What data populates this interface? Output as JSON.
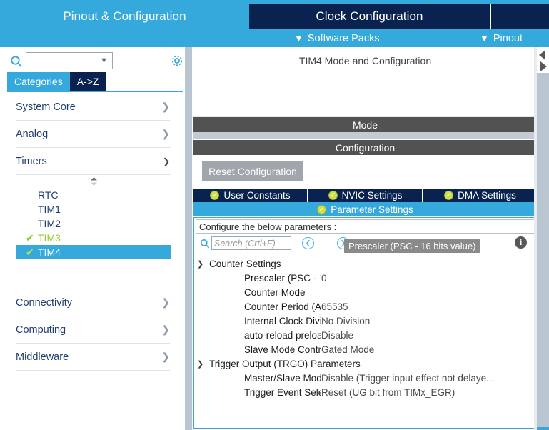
{
  "topbar": {
    "tabs": [
      {
        "label": "Pinout & Configuration",
        "state": "active-light"
      },
      {
        "label": "Clock Configuration",
        "state": "active-dark"
      }
    ],
    "subitems": [
      {
        "label": "Software Packs",
        "icon": "chevron-down-icon"
      },
      {
        "label": "Pinout",
        "icon": "chevron-down-icon"
      }
    ],
    "accent_blue": "#35a8dc",
    "navy": "#0a2250"
  },
  "sidebar": {
    "search": {
      "value": "",
      "placeholder": "",
      "icon": "search-icon",
      "dropdown_icon": "chevron-down-icon"
    },
    "settings_icon": "gear-icon",
    "tabs": [
      {
        "label": "Categories",
        "selected": true
      },
      {
        "label": "A->Z",
        "selected": false
      }
    ],
    "categories": [
      {
        "label": "System Core",
        "icon": "chevron-right-icon",
        "expanded": false
      },
      {
        "label": "Analog",
        "icon": "chevron-right-icon",
        "expanded": false
      },
      {
        "label": "Timers",
        "icon": "chevron-down-icon",
        "expanded": true
      }
    ],
    "categories_after": [
      {
        "label": "Connectivity",
        "icon": "chevron-right-icon",
        "expanded": false
      },
      {
        "label": "Computing",
        "icon": "chevron-right-icon",
        "expanded": false
      },
      {
        "label": "Middleware",
        "icon": "chevron-right-icon",
        "expanded": false
      }
    ],
    "timers": [
      {
        "label": "RTC",
        "checked": false,
        "selected": false
      },
      {
        "label": "TIM1",
        "checked": false,
        "selected": false
      },
      {
        "label": "TIM2",
        "checked": false,
        "selected": false
      },
      {
        "label": "TIM3",
        "checked": true,
        "selected": false
      },
      {
        "label": "TIM4",
        "checked": true,
        "selected": true
      }
    ],
    "scroll_spinner_icon": "up-down-spinner-icon",
    "check_glyph": "✔",
    "selected_color": "#35a8dc",
    "configured_color": "#9ec62b"
  },
  "main": {
    "title": "TIM4 Mode and Configuration",
    "mode_band": "Mode",
    "configuration_band": "Configuration",
    "reset_button": "Reset Configuration",
    "tabs": [
      {
        "label": "User Constants",
        "icon": "check-circle-icon",
        "selected": false
      },
      {
        "label": "NVIC Settings",
        "icon": "check-circle-icon",
        "selected": false
      },
      {
        "label": "DMA Settings",
        "icon": "check-circle-icon",
        "selected": false
      }
    ],
    "tab_selected": {
      "label": "Parameter Settings",
      "icon": "check-circle-icon",
      "selected": true
    },
    "configure_hint": "Configure the below parameters :",
    "search": {
      "placeholder": "Search (Crtl+F)",
      "value": "",
      "icon": "search-icon",
      "prev_icon": "chevron-left-circle-icon",
      "next_icon": "chevron-right-circle-icon"
    },
    "info_icon": "info-icon",
    "tooltip": "Prescaler (PSC - 16 bits value)",
    "groups": [
      {
        "label": "Counter Settings",
        "expanded": true,
        "twisty_icon": "chevron-down-icon",
        "params": [
          {
            "name": "Prescaler (PSC - 16 bits val...",
            "value": "0"
          },
          {
            "name": "Counter Mode",
            "value": ""
          },
          {
            "name": "Counter Period (AutoReload...",
            "value": "65535"
          },
          {
            "name": "Internal Clock Division (CKD)",
            "value": "No Division"
          },
          {
            "name": "auto-reload preload",
            "value": "Disable"
          },
          {
            "name": "Slave Mode Controller",
            "value": "Gated Mode"
          }
        ]
      },
      {
        "label": "Trigger Output (TRGO) Parameters",
        "expanded": true,
        "twisty_icon": "chevron-down-icon",
        "params": [
          {
            "name": "Master/Slave Mode (MSM bit)",
            "value": "Disable (Trigger input effect not delaye..."
          },
          {
            "name": "Trigger Event Selection",
            "value": "Reset (UG bit from TIMx_EGR)"
          }
        ]
      }
    ]
  },
  "right_edge": {
    "collapse_left_icon": "triangle-left-icon",
    "expand_right_icon": "triangle-right-icon"
  }
}
